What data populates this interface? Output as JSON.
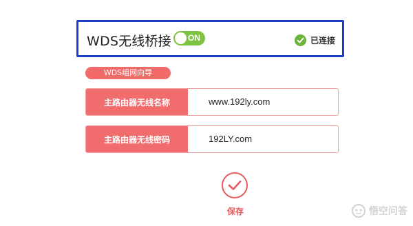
{
  "wds": {
    "title": "WDS无线桥接",
    "toggle_label": "ON",
    "status": "已连接"
  },
  "wizard": {
    "tag": "WDS组网向导",
    "fields": [
      {
        "label": "主路由器无线名称",
        "value": "www.192ly.com"
      },
      {
        "label": "主路由器无线密码",
        "value": "192LY.com"
      }
    ]
  },
  "save": {
    "label": "保存"
  },
  "watermark": {
    "text": "悟空问答"
  },
  "colors": {
    "panel_border": "#1e3fc8",
    "toggle_on": "#7dc243",
    "accent_red": "#f16c6c",
    "connected_green": "#6cb33a"
  }
}
